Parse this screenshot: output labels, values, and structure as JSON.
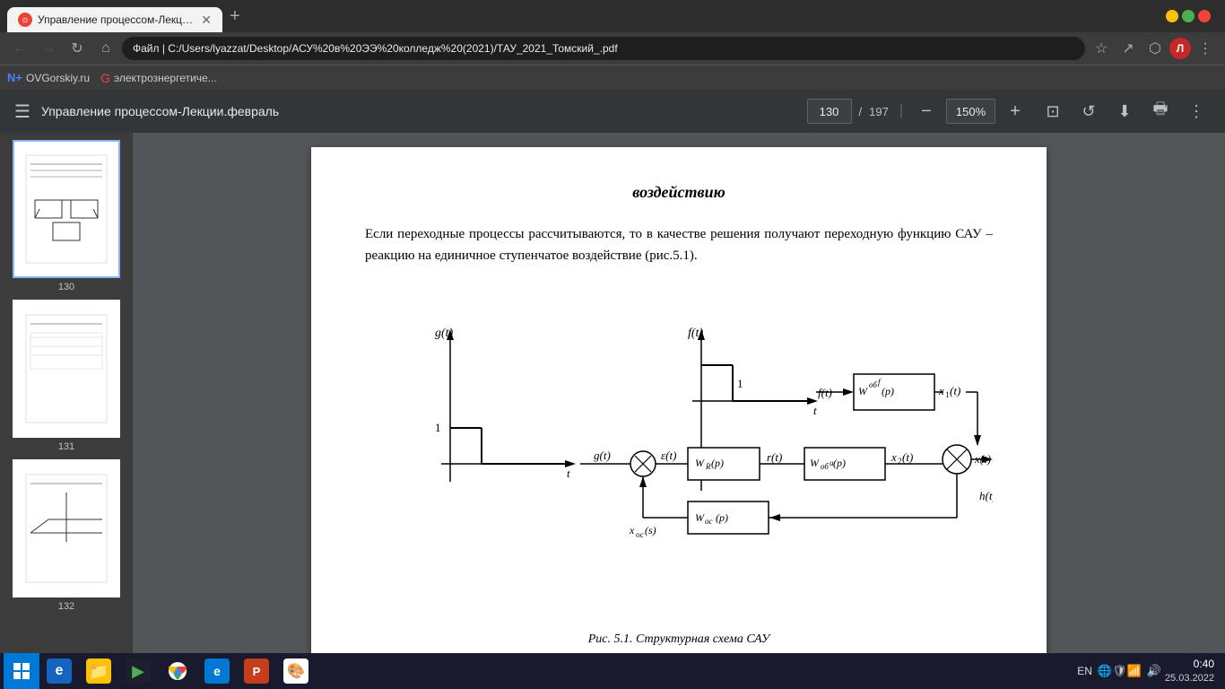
{
  "browser": {
    "tab_title": "Управление процессом-Лекци...",
    "address": "Файл | C:/Users/lyazzat/Desktop/АСУ%20в%20ЭЭ%20колледж%20(2021)/ТАУ_2021_Томский_.pdf",
    "new_tab_label": "+",
    "bookmark1": "OVGorskiy.ru",
    "bookmark2": "электрознергетиче...",
    "profile_letter": "Л"
  },
  "pdf": {
    "title": "Управление процессом-Лекции.февраль",
    "page_current": "130",
    "page_total": "197",
    "zoom": "150%",
    "thumb_pages": [
      "130",
      "131",
      "132"
    ]
  },
  "page_content": {
    "heading": "воздействию",
    "paragraph": "Если переходные процессы рассчитываются, то в качестве решения получают переходную функцию САУ – реакцию на единичное ступенчатое воздействие (рис.5.1).",
    "fig_caption": "Рис. 5.1. Структурная схема САУ"
  },
  "taskbar": {
    "time": "0:40",
    "date": "25.03.2022",
    "lang": "EN"
  }
}
